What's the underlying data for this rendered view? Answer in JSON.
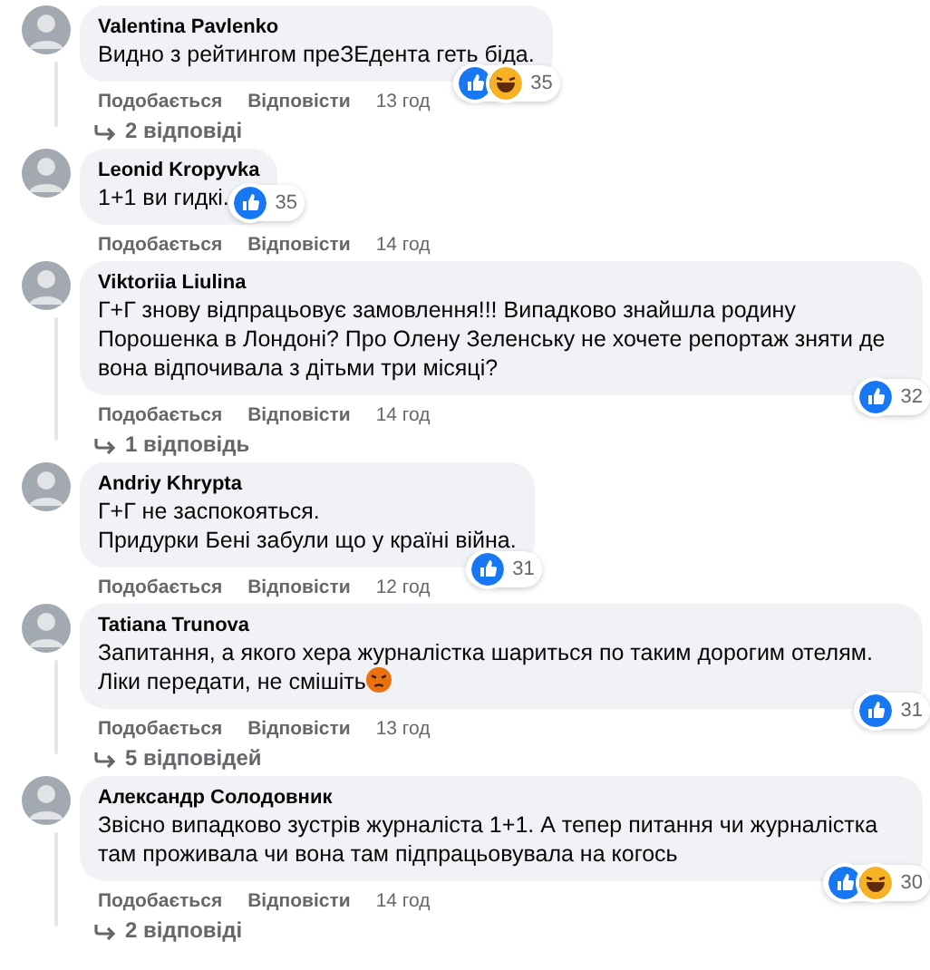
{
  "comments": [
    {
      "author": "Valentina Pavlenko",
      "text": "Видно з рейтингом преЗЕдента геть біда.",
      "reactions": [
        {
          "kind": "like"
        },
        {
          "kind": "haha"
        }
      ],
      "reaction_count": "35",
      "actions": [
        "Подобається",
        "Відповісти"
      ],
      "time": "13 год",
      "replies": "2 відповіді"
    },
    {
      "author": "Leonid Kropyvka",
      "text": "1+1 ви гидкі.",
      "reactions": [
        {
          "kind": "like"
        }
      ],
      "reaction_count": "35",
      "actions": [
        "Подобається",
        "Відповісти"
      ],
      "time": "14 год"
    },
    {
      "author": "Viktoriia Liulina",
      "text": "Г+Г знову відпрацьовує замовлення!!! Випадково знайшла родину Порошенка в Лондоні? Про Олену Зеленську не хочете репортаж зняти де вона відпочивала з дітьми три місяці?",
      "reactions": [
        {
          "kind": "like"
        }
      ],
      "reaction_count": "32",
      "actions": [
        "Подобається",
        "Відповісти"
      ],
      "time": "14 год",
      "replies": "1 відповідь"
    },
    {
      "author": "Andriy Khrypta",
      "text": "Г+Г не заспокояться.\nПридурки Бені забули що у країні війна.",
      "reactions": [
        {
          "kind": "like"
        }
      ],
      "reaction_count": "31",
      "actions": [
        "Подобається",
        "Відповісти"
      ],
      "time": "12 год"
    },
    {
      "author": "Tatiana Trunova",
      "text": "Запитання, а якого хера журналістка шариться по таким дорогим отелям. Ліки передати, не смішіть",
      "inline_emoji": {
        "kind": "angry"
      },
      "reactions": [
        {
          "kind": "like"
        }
      ],
      "reaction_count": "31",
      "actions": [
        "Подобається",
        "Відповісти"
      ],
      "time": "13 год",
      "replies": "5 відповідей"
    },
    {
      "author": "Александр Солодовник",
      "text": "Звісно випадково зустрів журналіста 1+1. А тепер питання чи журналістка там проживала чи вона там підпрацьовувала на когось",
      "reactions": [
        {
          "kind": "like"
        },
        {
          "kind": "haha"
        }
      ],
      "reaction_count": "30",
      "actions": [
        "Подобається",
        "Відповісти"
      ],
      "time": "14 год",
      "replies": "2 відповіді"
    }
  ]
}
